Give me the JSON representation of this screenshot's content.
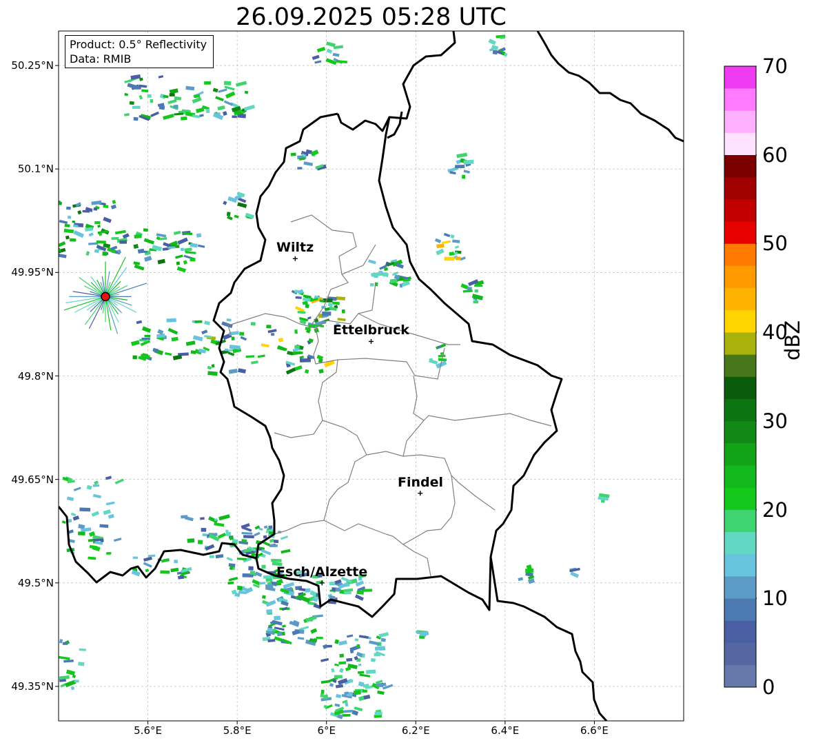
{
  "title": "26.09.2025 05:28 UTC",
  "infobox": {
    "product": "Product: 0.5° Reflectivity",
    "source": "Data: RMIB"
  },
  "map": {
    "lon_range": [
      5.4,
      6.8
    ],
    "lat_range": [
      49.3,
      50.3
    ],
    "grid": true,
    "lat_ticks": [
      {
        "value": 50.25,
        "label": "50.25°N"
      },
      {
        "value": 50.1,
        "label": "50.1°N"
      },
      {
        "value": 49.95,
        "label": "49.95°N"
      },
      {
        "value": 49.8,
        "label": "49.8°N"
      },
      {
        "value": 49.65,
        "label": "49.65°N"
      },
      {
        "value": 49.5,
        "label": "49.5°N"
      },
      {
        "value": 49.35,
        "label": "49.35°N"
      }
    ],
    "lon_ticks": [
      {
        "value": 5.6,
        "label": "5.6°E"
      },
      {
        "value": 5.8,
        "label": "5.8°E"
      },
      {
        "value": 6.0,
        "label": "6°E"
      },
      {
        "value": 6.2,
        "label": "6.2°E"
      },
      {
        "value": 6.4,
        "label": "6.4°E"
      },
      {
        "value": 6.6,
        "label": "6.6°E"
      }
    ],
    "cities": [
      {
        "name": "Wiltz",
        "lon": 5.93,
        "lat": 49.97
      },
      {
        "name": "Ettelbruck",
        "lon": 6.1,
        "lat": 49.85
      },
      {
        "name": "Findel",
        "lon": 6.21,
        "lat": 49.63
      },
      {
        "name": "Esch/Alzette",
        "lon": 5.99,
        "lat": 49.5
      }
    ],
    "radar_site": {
      "lon": 5.505,
      "lat": 49.915,
      "color": "#e81010"
    }
  },
  "colorbar": {
    "label": "dBZ",
    "min": 0,
    "max": 70,
    "step": 2.5,
    "ticks": [
      "0",
      "10",
      "20",
      "30",
      "40",
      "50",
      "60",
      "70"
    ],
    "colors": [
      "#6677aa",
      "#5566a0",
      "#4a5fa3",
      "#4c79b1",
      "#5b9bc6",
      "#68c3dc",
      "#62d8c3",
      "#3fd46f",
      "#14c81c",
      "#12b81c",
      "#12a316",
      "#108a14",
      "#0c7410",
      "#0a5c0c",
      "#46771a",
      "#a9b20a",
      "#ffd400",
      "#ffb300",
      "#ff9a00",
      "#ff7a00",
      "#e60000",
      "#c20000",
      "#a00000",
      "#7a0000",
      "#ffe2ff",
      "#ffb0ff",
      "#ff7aff",
      "#ee3cf2"
    ]
  }
}
